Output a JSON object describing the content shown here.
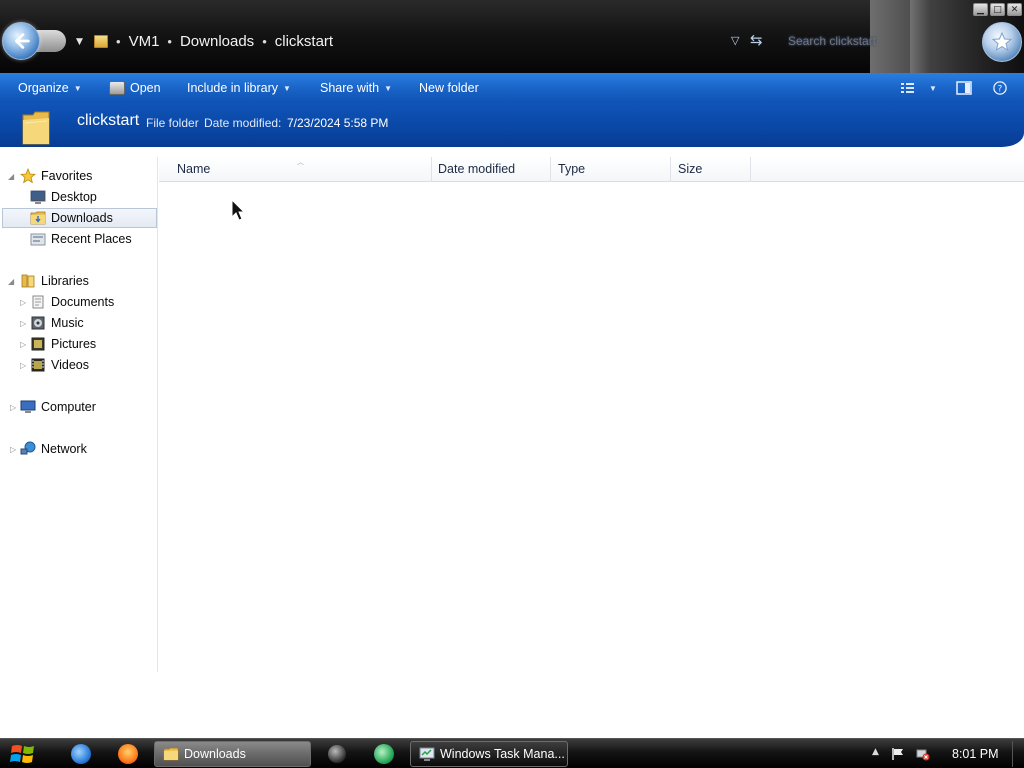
{
  "address_bar": {
    "breadcrumb": [
      "VM1",
      "Downloads",
      "clickstart"
    ],
    "search_placeholder": "Search clickstart"
  },
  "command_bar": {
    "organize": "Organize",
    "open": "Open",
    "include_in_library": "Include in library",
    "share_with": "Share with",
    "new_folder": "New folder"
  },
  "details": {
    "name": "clickstart",
    "type": "File folder",
    "date_modified_label": "Date modified:",
    "date_modified_value": "7/23/2024 5:58 PM"
  },
  "nav_pane": {
    "favorites": {
      "label": "Favorites",
      "items": [
        "Desktop",
        "Downloads",
        "Recent Places"
      ],
      "selected": "Downloads"
    },
    "libraries": {
      "label": "Libraries",
      "items": [
        "Documents",
        "Music",
        "Pictures",
        "Videos"
      ]
    },
    "computer": "Computer",
    "network": "Network"
  },
  "file_list": {
    "columns": [
      "Name",
      "Date modified",
      "Type",
      "Size"
    ],
    "rows": []
  },
  "taskbar": {
    "tasks": [
      "Downloads",
      "Windows Task Mana..."
    ],
    "clock": "8:01 PM"
  },
  "icons": {
    "back": "back-arrow-icon",
    "search": "search-icon",
    "start": "windows-start-icon"
  },
  "colors": {
    "command_bar": "#1a64c8",
    "details_bar": "#0a47a6",
    "title_bar": "#141414",
    "taskbar": "#141414"
  }
}
